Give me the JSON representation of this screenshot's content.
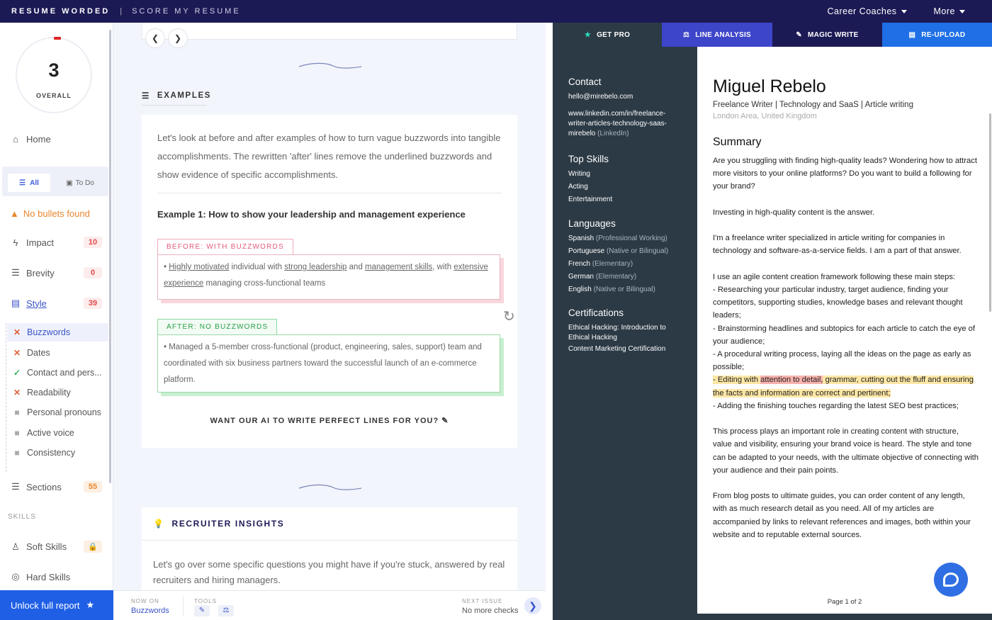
{
  "topbar": {
    "brand": "RESUME WORDED",
    "separator": "|",
    "section": "SCORE MY RESUME",
    "nav": [
      {
        "label": "Career Coaches"
      },
      {
        "label": "More"
      }
    ]
  },
  "sidebar": {
    "score": "3",
    "score_label": "OVERALL",
    "home": "Home",
    "filter_all": "All",
    "filter_todo": "To Do",
    "warning": "No bullets found",
    "categories": [
      {
        "label": "Impact",
        "count": "10"
      },
      {
        "label": "Brevity",
        "count": "0"
      },
      {
        "label": "Style",
        "count": "39"
      }
    ],
    "style_items": [
      {
        "label": "Buzzwords",
        "status": "fail"
      },
      {
        "label": "Dates",
        "status": "fail"
      },
      {
        "label": "Contact and pers...",
        "status": "pass"
      },
      {
        "label": "Readability",
        "status": "fail"
      },
      {
        "label": "Personal pronouns",
        "status": "locked"
      },
      {
        "label": "Active voice",
        "status": "locked"
      },
      {
        "label": "Consistency",
        "status": "locked"
      }
    ],
    "sections": {
      "label": "Sections",
      "count": "55"
    },
    "skills_heading": "SKILLS",
    "soft_skills": "Soft Skills",
    "hard_skills": "Hard Skills",
    "unlock": "Unlock full report"
  },
  "examples": {
    "heading": "EXAMPLES",
    "intro": "Let's look at before and after examples of how to turn vague buzzwords into tangible accomplishments. The rewritten 'after' lines remove the underlined buzzwords and show evidence of specific accomplishments.",
    "example_title": "Example 1: How to show your leadership and management experience",
    "before_tag": "BEFORE: WITH BUZZWORDS",
    "before_parts": {
      "bullet": "• ",
      "b1": "Highly motivated",
      "t1": " individual with ",
      "b2": "strong leadership",
      "t2": " and ",
      "b3": "management skills",
      "t3": ", with ",
      "b4": "extensive experience",
      "t4": " managing cross-functional teams"
    },
    "after_tag": "AFTER: NO BUZZWORDS",
    "after_text": "• Managed a 5-member cross-functional (product, engineering, sales, support) team and coordinated with six business partners toward the successful launch of an e-commerce platform.",
    "ai_cta": "WANT OUR AI TO WRITE PERFECT LINES FOR YOU?"
  },
  "recruiter": {
    "heading": "RECRUITER INSIGHTS",
    "text": "Let's go over some specific questions you might have if you're stuck, answered by real recruiters and hiring managers."
  },
  "bottombar": {
    "now_on_label": "NOW ON",
    "now_on_value": "Buzzwords",
    "tools_label": "TOOLS",
    "next_label": "NEXT ISSUE",
    "next_value": "No more checks"
  },
  "resume_tabs": [
    {
      "label": "GET PRO",
      "icon": "star-icon",
      "color": "#2c3a45"
    },
    {
      "label": "LINE ANALYSIS",
      "icon": "analysis-icon",
      "color": "#3d45c9"
    },
    {
      "label": "MAGIC WRITE",
      "icon": "magic-wand-icon",
      "color": "#1c1a55"
    },
    {
      "label": "RE-UPLOAD",
      "icon": "file-icon",
      "color": "#1f6fe6"
    }
  ],
  "resume": {
    "contact_heading": "Contact",
    "email": "hello@mirebelo.com",
    "linkedin": "www.linkedin.com/in/freelance-writer-articles-technology-saas-mirebelo",
    "linkedin_suffix": "(LinkedIn)",
    "skills_heading": "Top Skills",
    "skills": [
      "Writing",
      "Acting",
      "Entertainment"
    ],
    "languages_heading": "Languages",
    "languages": [
      {
        "name": "Spanish",
        "level": "(Professional Working)"
      },
      {
        "name": "Portuguese",
        "level": "(Native or Bilingual)"
      },
      {
        "name": "French",
        "level": "(Elementary)"
      },
      {
        "name": "German",
        "level": "(Elementary)"
      },
      {
        "name": "English",
        "level": "(Native or Bilingual)"
      }
    ],
    "certs_heading": "Certifications",
    "certs": [
      "Ethical Hacking: Introduction to Ethical Hacking",
      "Content Marketing Certification"
    ],
    "name": "Miguel Rebelo",
    "title": "Freelance Writer | Technology and SaaS | Article writing",
    "location": "London Area, United Kingdom",
    "summary_heading": "Summary",
    "p1": "Are you struggling with finding high-quality leads? Wondering how to attract more visitors to your online platforms? Do you want to build a following for your brand?",
    "p2": "Investing in high-quality content is the answer.",
    "p3": "I'm a freelance writer specialized in article writing for companies in technology and software-as-a-service fields. I am a part of that answer.",
    "p4_intro": "I use an agile content creation framework following these main steps:",
    "step1": "- Researching your particular industry, target audience, finding your competitors, supporting studies, knowledge bases and relevant thought leaders;",
    "step2": "- Brainstorming headlines and subtopics for each article to catch the eye of your audience;",
    "step3": "- A procedural writing process, laying all the ideas on the page as early as possible;",
    "step4_a": "- Editing with ",
    "step4_red": "attention to detail,",
    "step4_b": " grammar, cutting out the fluff and ensuring the facts and information are correct and pertinent;",
    "step5": "- Adding the finishing touches regarding the latest SEO best practices;",
    "p5": "This process plays an important role in creating content with structure, value and visibility, ensuring your brand voice is heard. The style and tone can be adapted to your needs, with the ultimate objective of connecting with your audience and their pain points.",
    "p6": "From blog posts to ultimate guides, you can order content of any length, with as much research detail as you need. All of my articles are accompanied by links to relevant references and images, both within your website and to reputable external sources.",
    "page": "Page 1 of 2"
  }
}
